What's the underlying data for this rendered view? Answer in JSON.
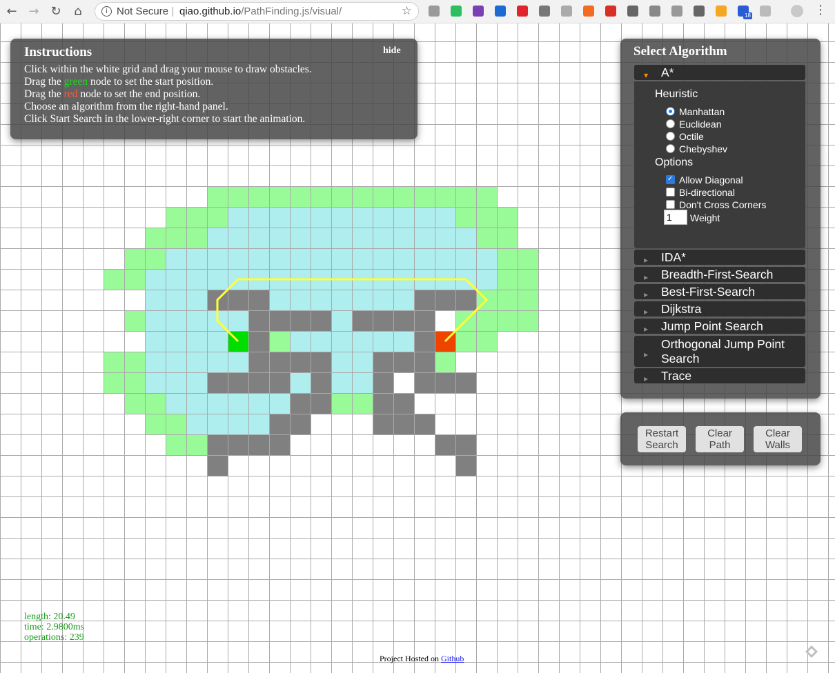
{
  "browser": {
    "security_label": "Not Secure",
    "url_host": "qiao.github.io",
    "url_path": "/PathFinding.js/visual/",
    "extensions": [
      "kk-icon",
      "evernote-icon",
      "onenote-icon",
      "v-icon",
      "pig-icon",
      "angular-icon",
      "puzzle-icon",
      "x-icon",
      "gmail-icon",
      "lightbulb-icon",
      "doc-icon",
      "gear-icon",
      "code-icon",
      "k-icon",
      "calendar-icon",
      "grid-icon"
    ],
    "extension_badge": "18"
  },
  "instructions": {
    "title": "Instructions",
    "hide_label": "hide",
    "line1": "Click within the white grid and drag your mouse to draw obstacles.",
    "line2_a": "Drag the ",
    "line2_color": "green",
    "line2_b": " node to set the start position.",
    "line3_a": "Drag the ",
    "line3_color": "red",
    "line3_b": " node to set the end position.",
    "line4": "Choose an algorithm from the right-hand panel.",
    "line5": "Click Start Search in the lower-right corner to start the animation."
  },
  "algorithm_panel": {
    "title": "Select Algorithm",
    "selected": "A*",
    "astar": {
      "heuristic_heading": "Heuristic",
      "heuristics": [
        {
          "label": "Manhattan",
          "checked": true
        },
        {
          "label": "Euclidean",
          "checked": false
        },
        {
          "label": "Octile",
          "checked": false
        },
        {
          "label": "Chebyshev",
          "checked": false
        }
      ],
      "options_heading": "Options",
      "options": [
        {
          "label": "Allow Diagonal",
          "checked": true
        },
        {
          "label": "Bi-directional",
          "checked": false
        },
        {
          "label": "Don't Cross Corners",
          "checked": false
        }
      ],
      "weight_value": "1",
      "weight_label": "Weight"
    },
    "others": [
      "IDA*",
      "Breadth-First-Search",
      "Best-First-Search",
      "Dijkstra",
      "Jump Point Search",
      "Orthogonal Jump Point Search",
      "Trace"
    ]
  },
  "controls": {
    "restart_label": "Restart Search",
    "clear_path_label": "Clear Path",
    "clear_walls_label": "Clear Walls"
  },
  "stats": {
    "length": "length: 20.49",
    "time": "time: 2.9800ms",
    "operations": "operations: 239"
  },
  "footer": {
    "text": "Project Hosted on ",
    "link": "Github"
  },
  "colors": {
    "open": "#98fb98",
    "closed": "#afeeee",
    "wall": "#808080",
    "start": "#00dd00",
    "end": "#ee4400",
    "path": "#ffff33",
    "grid_line": "#a9a9a9"
  },
  "grid": {
    "walls": "10,13;11,13;12,13;20,13;21,13;22,13;12,14;13,14;14,14;15,14;17,14;18,14;19,14;20,14;12,15;20,15;12,16;13,16;14,16;15,16;18,16;19,16;20,16;10,17;11,17;12,17;13,17;15,17;18,17;20,17;21,17;22,17;14,18;15,18;18,18;19,18;13,19;14,19;18,19;19,19;20,19;10,20;11,20;12,20;13,20;21,20;22,20;10,21;22,21",
    "open": "10,8;11,8;12,8;13,8;14,8;15,8;16,8;17,8;18,8;19,8;20,8;21,8;22,8;23,8;8,9;9,9;10,9;22,9;23,9;24,9;7,10;8,10;9,10;23,10;24,10;6,11;7,11;24,11;25,11;5,12;6,12;24,12;25,12;23,13;24,13;25,13;6,14;22,14;23,14;24,14;25,14;13,15;21,15;22,15;23,15;5,16;6,16;21,16;5,17;6,17;6,18;7,18;16,18;17,18;7,19;8,19;8,20;9,20",
    "closed": "11,9;12,9;13,9;14,9;15,9;16,9;17,9;18,9;19,9;20,9;21,9;10,10;11,10;12,10;13,10;14,10;15,10;16,10;17,10;18,10;19,10;20,10;21,10;22,10;8,11;9,11;10,11;11,11;12,11;13,11;14,11;15,11;16,11;17,11;18,11;19,11;20,11;21,11;22,11;23,11;7,12;8,12;9,12;10,12;11,12;12,12;13,12;14,12;15,12;16,12;17,12;18,12;19,12;20,12;21,12;22,12;23,12;7,13;8,13;9,13;13,13;14,13;15,13;16,13;17,13;18,13;19,13;7,14;8,14;9,14;10,14;11,14;16,14;7,15;8,15;9,15;10,15;14,15;15,15;16,15;17,15;18,15;19,15;7,16;8,16;9,16;10,16;11,16;16,16;17,16;7,17;8,17;9,17;14,17;16,17;17,17;8,18;9,18;10,18;11,18;12,18;13,18;9,19;10,19;11,19;12,19",
    "start": "11,15",
    "end": "21,15",
    "path": "11,15;10,14;10,13;11,12;12,12;13,12;14,12;15,12;16,12;17,12;18,12;19,12;20,12;21,12;22,12;23,13;22,14;21,15"
  }
}
